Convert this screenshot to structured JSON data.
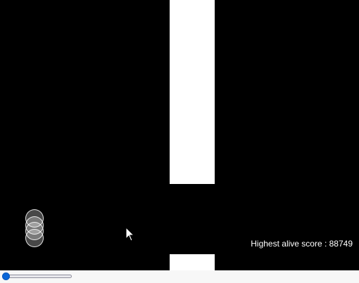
{
  "game": {
    "score_label": "Highest alive score",
    "score_value": 88749,
    "score_text": "Highest alive score : 88749",
    "bird_count": 4
  },
  "colors": {
    "background": "#000000",
    "pipe": "#ffffff",
    "text": "#ffffff",
    "slider_accent": "#0a66d8"
  },
  "controls": {
    "speed_slider_value": 0
  }
}
